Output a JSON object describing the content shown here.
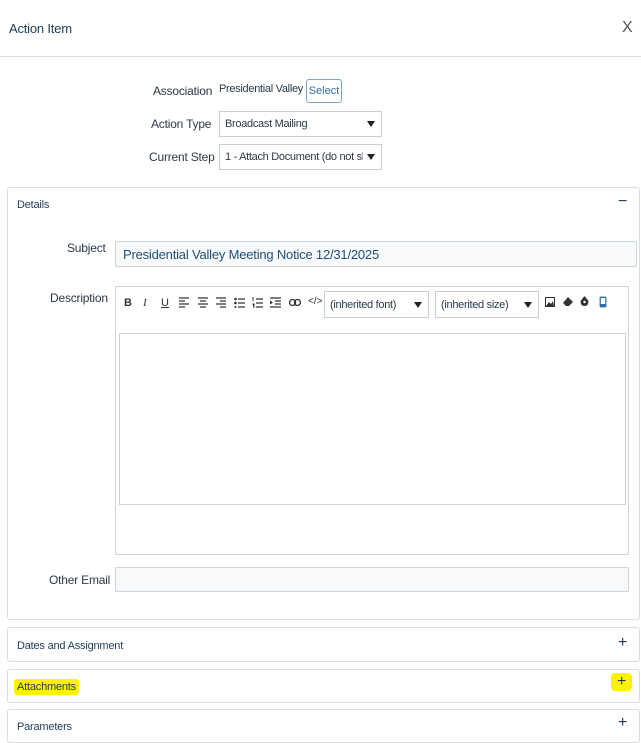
{
  "header": {
    "title": "Action Item",
    "close": "X"
  },
  "form": {
    "association": {
      "label": "Association",
      "value": "Presidential Valley",
      "button": "Select"
    },
    "action_type": {
      "label": "Action Type",
      "value": "Broadcast Mailing"
    },
    "current_step": {
      "label": "Current Step",
      "value": "1 - Attach Document (do not skip t..."
    }
  },
  "details": {
    "title": "Details",
    "toggle": "−",
    "subject": {
      "label": "Subject",
      "value": "Presidential Valley Meeting Notice 12/31/2025"
    },
    "description": {
      "label": "Description",
      "toolbar": {
        "bold": "B",
        "italic": "I",
        "underline": "U",
        "font": "(inherited font)",
        "size": "(inherited size)",
        "code": "</>"
      }
    },
    "other_email": {
      "label": "Other Email",
      "value": ""
    }
  },
  "sections": [
    {
      "title": "Dates and Assignment",
      "toggle": "+"
    },
    {
      "title": "Attachments",
      "toggle": "+"
    },
    {
      "title": "Parameters",
      "toggle": "+"
    }
  ],
  "colors": {
    "highlight": "#fff200",
    "accent": "#2f6da3"
  }
}
